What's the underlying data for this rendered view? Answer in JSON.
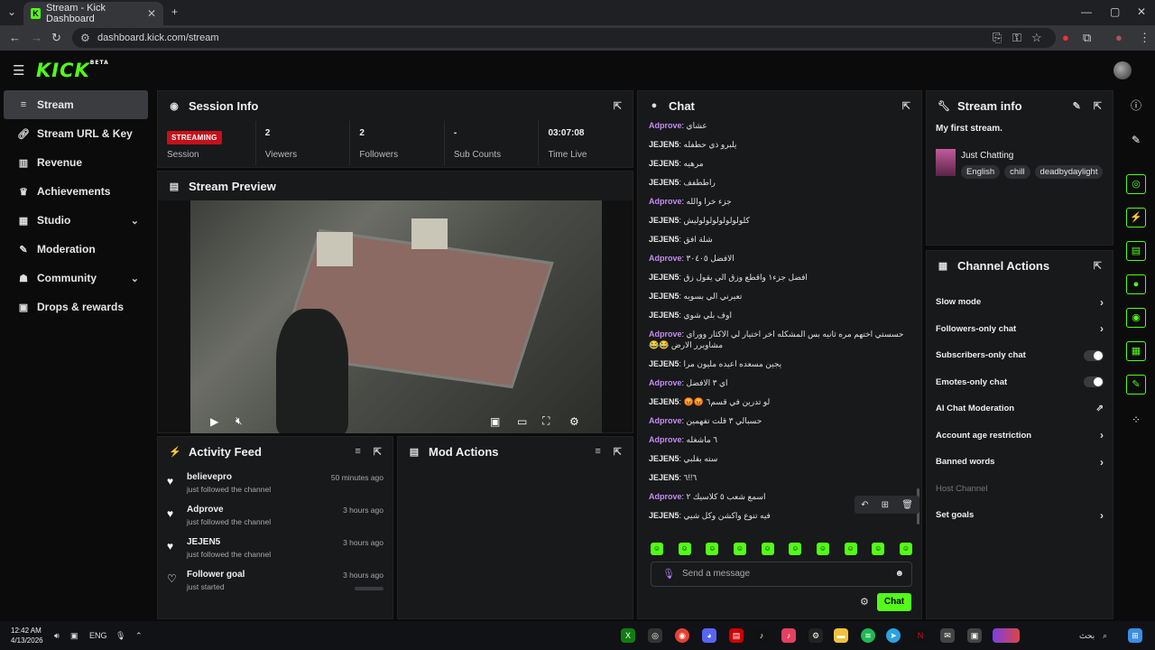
{
  "browser": {
    "tab_title": "Stream - Kick Dashboard",
    "url": "dashboard.kick.com/stream"
  },
  "app": {
    "logo": "KICK",
    "logo_sup": "BETA"
  },
  "sidebar": {
    "items": [
      {
        "label": "Stream",
        "icon": "broadcast-icon"
      },
      {
        "label": "Stream URL & Key",
        "icon": "link-icon"
      },
      {
        "label": "Revenue",
        "icon": "chart-icon"
      },
      {
        "label": "Achievements",
        "icon": "trophy-icon"
      },
      {
        "label": "Studio",
        "icon": "studio-icon"
      },
      {
        "label": "Moderation",
        "icon": "wrench-icon"
      },
      {
        "label": "Community",
        "icon": "people-icon"
      },
      {
        "label": "Drops & rewards",
        "icon": "gift-icon"
      }
    ]
  },
  "session": {
    "title": "Session Info",
    "status_badge": "STREAMING",
    "status_label": "Session",
    "stats": [
      {
        "value": "2",
        "label": "Viewers"
      },
      {
        "value": "2",
        "label": "Followers"
      },
      {
        "value": "-",
        "label": "Sub Counts"
      },
      {
        "value": "03:07:08",
        "label": "Time Live"
      }
    ]
  },
  "preview": {
    "title": "Stream Preview"
  },
  "activity": {
    "title": "Activity Feed",
    "items": [
      {
        "name": "believepro",
        "sub": "just followed the channel",
        "time": "50 minutes ago"
      },
      {
        "name": "Adprove",
        "sub": "just followed the channel",
        "time": "3 hours ago"
      },
      {
        "name": "JEJEN5",
        "sub": "just followed the channel",
        "time": "3 hours ago"
      },
      {
        "name": "Follower goal",
        "sub": "just started",
        "time": "3 hours ago"
      }
    ]
  },
  "mod": {
    "title": "Mod Actions"
  },
  "chat": {
    "title": "Chat",
    "messages": [
      {
        "user": "Adprove",
        "text": "عشاي"
      },
      {
        "user": "JEJEN5",
        "text": "يلبرو ذي حطفله"
      },
      {
        "user": "JEJEN5",
        "text": "مرهيه"
      },
      {
        "user": "JEJEN5",
        "text": "راططفف"
      },
      {
        "user": "Adprove",
        "text": "جزء خرا والله"
      },
      {
        "user": "JEJEN5",
        "text": "كلولولولولولولوليش"
      },
      {
        "user": "JEJEN5",
        "text": "شلة افق"
      },
      {
        "user": "Adprove",
        "text": "الافضل ٣٠٤٠٥"
      },
      {
        "user": "JEJEN5",
        "text": "افضل جزء١ واقطع وزق الي يقول زق"
      },
      {
        "user": "JEJEN5",
        "text": "تعيرني الي بسويه"
      },
      {
        "user": "JEJEN5",
        "text": "اوف بلي شوي"
      },
      {
        "user": "Adprove",
        "text": "حسستي اختهم مره ثانيه بس المشكله اخر اختيار لي الاكثار ووراي مشاويرر الارض 😂😂"
      },
      {
        "user": "JEJEN5",
        "text": "يجين مسعده اعيده مليون مرا"
      },
      {
        "user": "Adprove",
        "text": "اي ٣ الافضل"
      },
      {
        "user": "JEJEN5",
        "text": "لو تدرين في قسم٦ 😡😡"
      },
      {
        "user": "Adprove",
        "text": "حسبالي ٣ قلت تفهمين"
      },
      {
        "user": "Adprove",
        "text": "٦ ماشغله"
      },
      {
        "user": "JEJEN5",
        "text": "سته بقلبي"
      },
      {
        "user": "JEJEN5",
        "text": "٦!!٦"
      },
      {
        "user": "Adprove",
        "text": "اسمع شعب ٥ كلاسيك ٢"
      },
      {
        "user": "JEJEN5",
        "text": "فيه تنوع واكشن وكل شيي"
      }
    ],
    "input_placeholder": "Send a message",
    "send_label": "Chat"
  },
  "stream_info": {
    "title": "Stream info",
    "stream_title": "My first stream.",
    "category": "Just Chatting",
    "tags": [
      "English",
      "chill",
      "deadbydaylight"
    ]
  },
  "channel_actions": {
    "title": "Channel Actions",
    "items": [
      {
        "label": "Slow mode"
      },
      {
        "label": "Followers-only chat"
      },
      {
        "label": "Subscribers-only chat"
      },
      {
        "label": "Emotes-only chat"
      },
      {
        "label": "AI Chat Moderation"
      },
      {
        "label": "Account age restriction"
      },
      {
        "label": "Banned words"
      },
      {
        "label": "Host Channel"
      },
      {
        "label": "Set goals"
      }
    ]
  },
  "taskbar": {
    "time": "12:42 AM",
    "date": "4/13/2026",
    "lang": "ENG",
    "search_label": "بحث"
  },
  "colors": {
    "accent": "#53fc18",
    "live": "#c4111c",
    "user_purple": "#c58bf5"
  }
}
